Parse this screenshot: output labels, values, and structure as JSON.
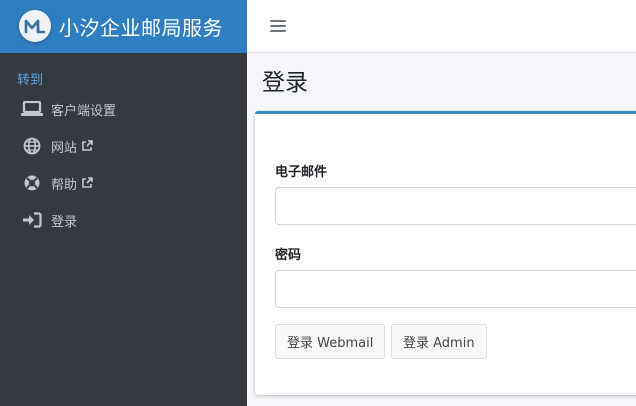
{
  "brand": {
    "title": "小汐企业邮局服务",
    "logo_text": "M"
  },
  "sidebar": {
    "header": "转到",
    "items": [
      {
        "label": "客户端设置",
        "icon": "laptop-icon",
        "external": false
      },
      {
        "label": "网站",
        "icon": "globe-icon",
        "external": true
      },
      {
        "label": "帮助",
        "icon": "lifebuoy-icon",
        "external": true
      },
      {
        "label": "登录",
        "icon": "sign-in-icon",
        "external": false
      }
    ]
  },
  "page": {
    "title": "登录"
  },
  "form": {
    "email_label": "电子邮件",
    "email_value": "",
    "password_label": "密码",
    "password_value": "",
    "webmail_button": "登录 Webmail",
    "admin_button": "登录 Admin"
  },
  "colors": {
    "brand_bg": "#2f7ec1",
    "sidebar_bg": "#343a40",
    "nav_header": "#5ea7e6",
    "card_accent": "#3c8dbc"
  }
}
